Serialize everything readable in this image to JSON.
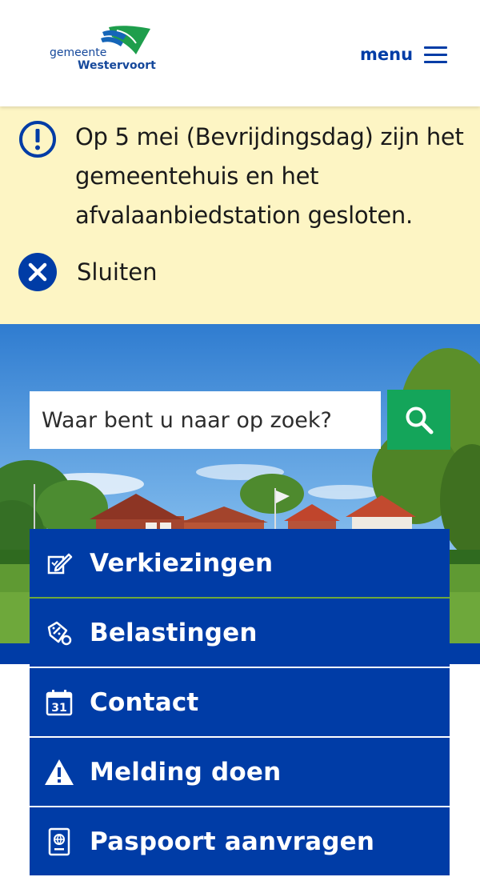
{
  "header": {
    "logo": {
      "line1": "gemeente",
      "line2": "Westervoort"
    },
    "menu_label": "menu"
  },
  "alert": {
    "message": "Op 5 mei (Bevrijdingsdag) zijn het gemeentehuis en het afvalaanbiedstation gesloten.",
    "close_label": "Sluiten"
  },
  "search": {
    "placeholder": "Waar bent u naar op zoek?"
  },
  "quick_links": [
    {
      "label": "Verkiezingen",
      "icon": "vote-icon"
    },
    {
      "label": "Belastingen",
      "icon": "tax-icon"
    },
    {
      "label": "Contact",
      "icon": "calendar-icon",
      "icon_text": "31"
    },
    {
      "label": "Melding doen",
      "icon": "warning-icon"
    },
    {
      "label": "Paspoort aanvragen",
      "icon": "passport-icon"
    }
  ],
  "colors": {
    "brand_blue": "#003ca6",
    "alert_bg": "#fdf5c4",
    "search_green": "#14a55a"
  }
}
